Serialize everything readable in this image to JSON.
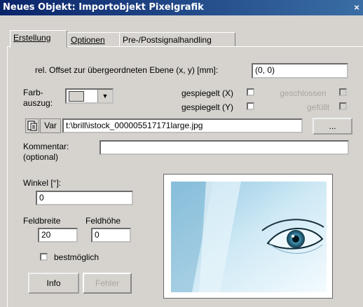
{
  "window": {
    "title": "Neues Objekt: Importobjekt Pixelgrafik",
    "close_glyph": "×"
  },
  "tabs": [
    {
      "label": "Erstellung",
      "active": true
    },
    {
      "label": "Optionen",
      "active": false
    },
    {
      "label": "Pre-/Postsignalhandling",
      "active": false
    }
  ],
  "offset": {
    "label": "rel. Offset zur übergeordneten Ebene (x, y) [mm]:",
    "value": "(0, 0)"
  },
  "farbauszug": {
    "label_line1": "Farb-",
    "label_line2": "auszug:",
    "arrow": "▼"
  },
  "checkboxes": {
    "gespiegelt_x": "gespiegelt (X)",
    "gespiegelt_y": "gespiegelt (Y)",
    "geschlossen": "geschlossen",
    "gefuellt": "gefüllt"
  },
  "file": {
    "var_label": "Var",
    "path": "t:\\brill\\istock_000005517171large.jpg",
    "browse_label": "..."
  },
  "kommentar": {
    "label_line1": "Kommentar:",
    "label_line2": "(optional)",
    "value": ""
  },
  "winkel": {
    "label": "Winkel [°]:",
    "value": "0"
  },
  "feldbreite": {
    "label": "Feldbreite",
    "value": "20"
  },
  "feldhoehe": {
    "label": "Feldhöhe",
    "value": "0"
  },
  "bestmoeglich": {
    "label": "bestmöglich"
  },
  "buttons": {
    "info": "Info",
    "fehler": "Fehler"
  },
  "preview": {
    "image": "eye-closeup-photo"
  },
  "colors": {
    "title_start": "#0a246a",
    "title_end": "#3a6ea5",
    "dialog_bg": "#d6d3ce",
    "disabled_text": "#a8a59e"
  }
}
